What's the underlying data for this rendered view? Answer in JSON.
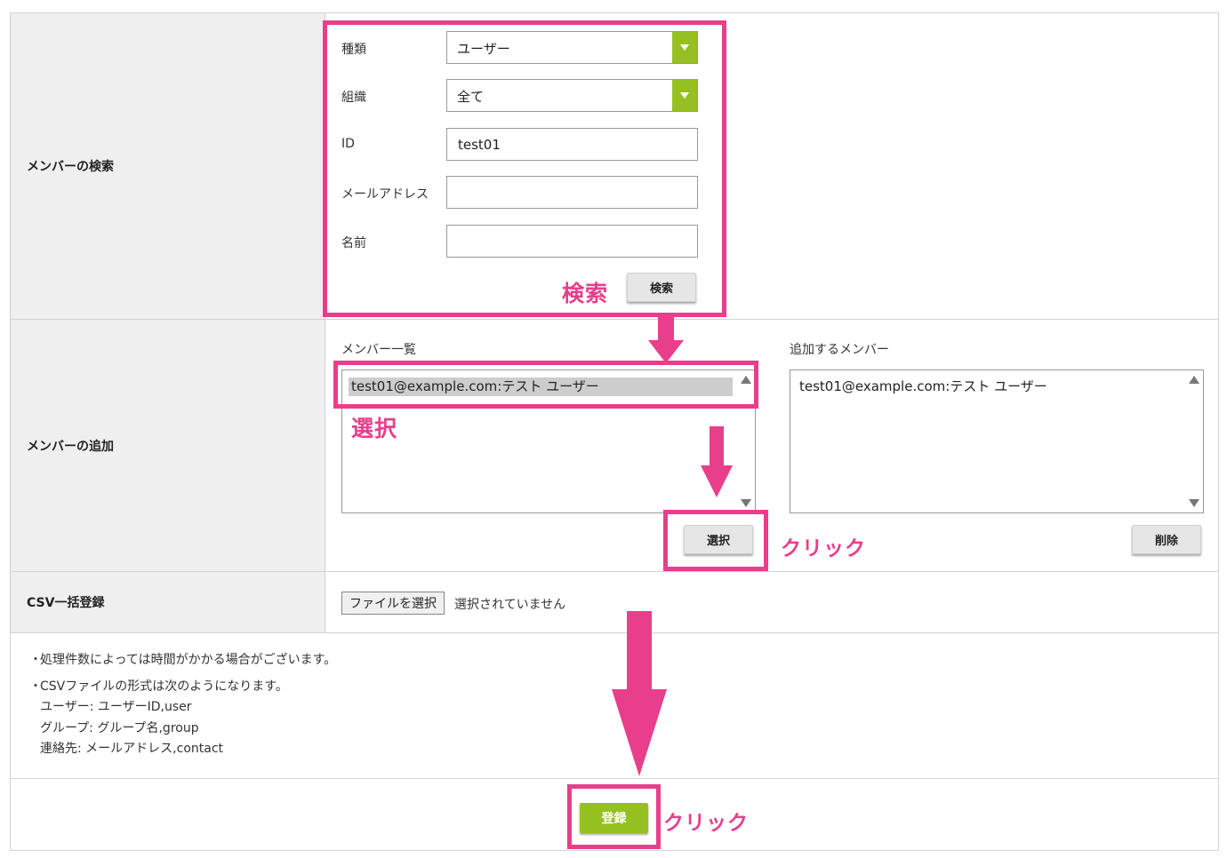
{
  "rows": {
    "search_label": "メンバーの検索",
    "add_label": "メンバーの追加",
    "csv_label": "CSV一括登録"
  },
  "search": {
    "type_label": "種類",
    "type_value": "ユーザー",
    "org_label": "組織",
    "org_value": "全て",
    "id_label": "ID",
    "id_value": "test01",
    "email_label": "メールアドレス",
    "email_value": "",
    "name_label": "名前",
    "name_value": "",
    "search_button": "検索"
  },
  "member_add": {
    "list_heading": "メンバー一覧",
    "list_items": [
      "test01@example.com:テスト ユーザー"
    ],
    "selected_heading": "追加するメンバー",
    "selected_items": [
      "test01@example.com:テスト ユーザー"
    ],
    "select_button": "選択",
    "delete_button": "削除"
  },
  "csv": {
    "file_button": "ファイルを選択",
    "file_status": "選択されていません"
  },
  "notes": {
    "bullet": "・",
    "line1": "処理件数によっては時間がかかる場合がございます。",
    "line2": "CSVファイルの形式は次のようになります。",
    "line3": "ユーザー: ユーザーID,user",
    "line4": "グループ: グループ名,group",
    "line5": "連絡先: メールアドレス,contact"
  },
  "footer": {
    "register_button": "登録"
  },
  "annotations": {
    "search": "検索",
    "select": "選択",
    "click1": "クリック",
    "click2": "クリック"
  },
  "colors": {
    "accent_green": "#94c11f",
    "annotation_pink": "#e83e8c"
  }
}
